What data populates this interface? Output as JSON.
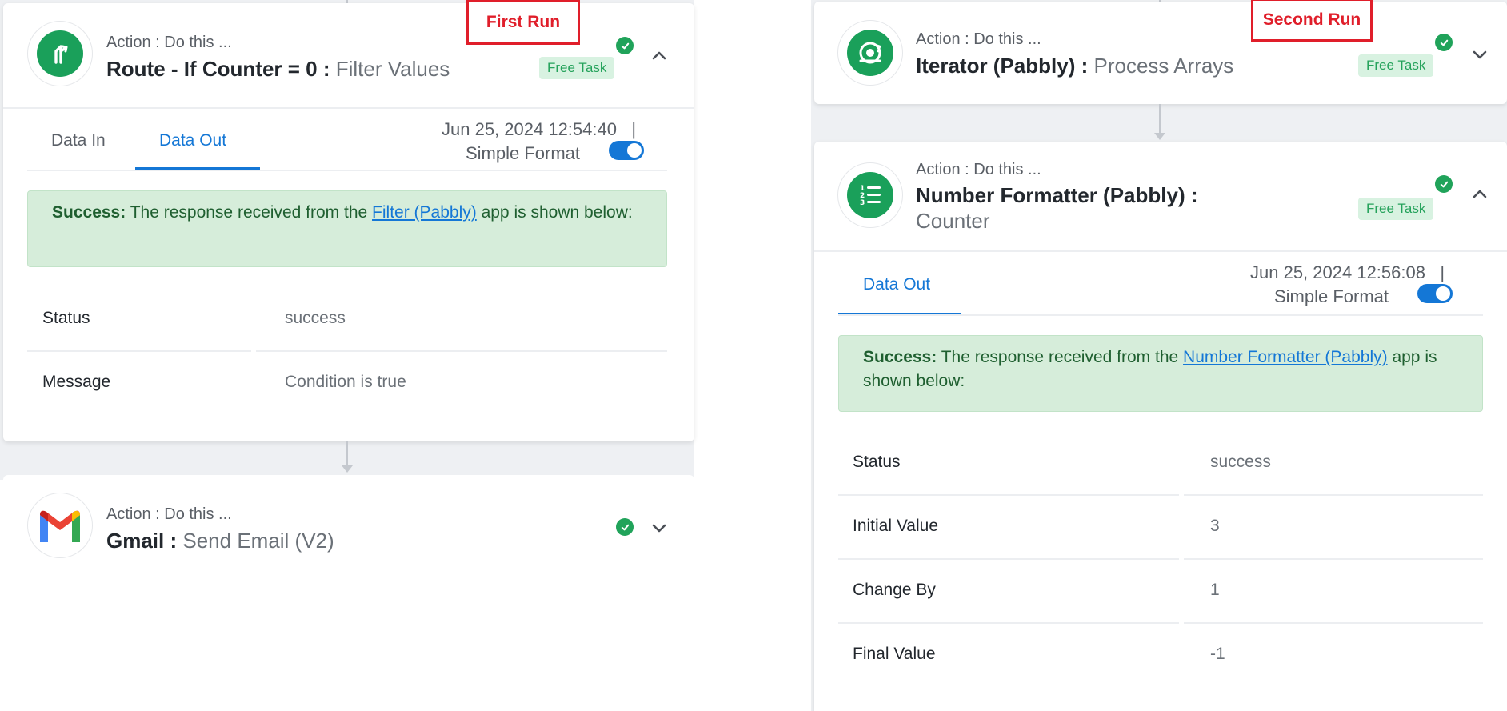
{
  "left": {
    "run_label": "First Run",
    "route_card": {
      "subtitle": "Action : Do this ...",
      "app": "Route - If Counter = 0 :",
      "event": "Filter Values",
      "badge": "Free Task",
      "tabs": [
        "Data In",
        "Data Out"
      ],
      "active_tab": "Data Out",
      "timestamp": "Jun 25, 2024 12:54:40",
      "separator": "|",
      "format_label": "Simple Format",
      "success_prefix": "Success:",
      "success_text_1": "The response received from the",
      "success_link": "Filter (Pabbly)",
      "success_text_2": "app is shown below:",
      "rows": [
        {
          "label": "Status",
          "value": "success"
        },
        {
          "label": "Message",
          "value": "Condition is true"
        }
      ]
    },
    "gmail_card": {
      "subtitle": "Action : Do this ...",
      "app": "Gmail :",
      "event": "Send Email (V2)"
    }
  },
  "right": {
    "run_label": "Second Run",
    "iterator_card": {
      "subtitle": "Action : Do this ...",
      "app": "Iterator (Pabbly) :",
      "event": "Process Arrays",
      "badge": "Free Task"
    },
    "formatter_card": {
      "subtitle": "Action : Do this ...",
      "app": "Number Formatter (Pabbly) :",
      "event": "Counter",
      "badge": "Free Task",
      "tab": "Data Out",
      "timestamp": "Jun 25, 2024 12:56:08",
      "separator": "|",
      "format_label": "Simple Format",
      "success_prefix": "Success:",
      "success_text_1": "The response received from the",
      "success_link": "Number Formatter (Pabbly)",
      "success_text_2": "app is shown below:",
      "rows": [
        {
          "label": "Status",
          "value": "success"
        },
        {
          "label": "Initial Value",
          "value": "3"
        },
        {
          "label": "Change By",
          "value": "1"
        },
        {
          "label": "Final Value",
          "value": "-1"
        }
      ]
    }
  },
  "colors": {
    "accent": "#1477d6",
    "success_green": "#20a35a",
    "success_bg": "#d6edda",
    "run_label_red": "#e01e2a"
  },
  "icons": {
    "route": "route-branch-icon",
    "gmail": "gmail-icon",
    "iterator": "iterator-icon",
    "formatter": "number-list-icon",
    "status": "check-circle-icon",
    "collapse": "chevron-up-icon",
    "expand": "chevron-down-icon"
  }
}
